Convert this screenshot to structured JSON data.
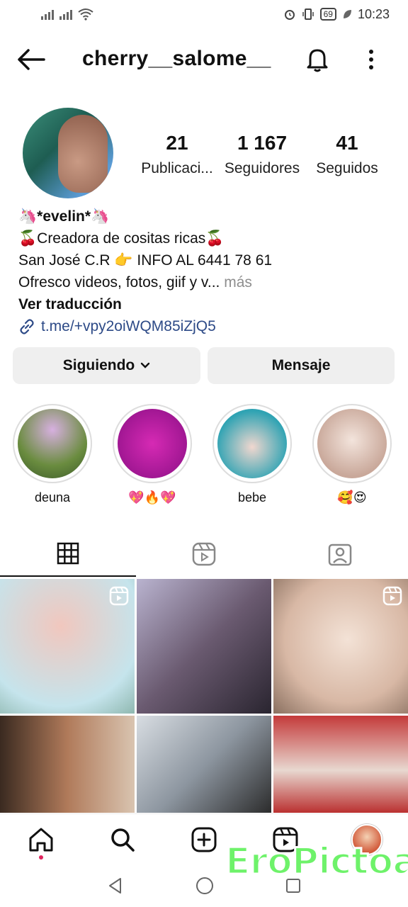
{
  "status_bar": {
    "time": "10:23",
    "battery": "69"
  },
  "header": {
    "username": "cherry__salome__"
  },
  "profile": {
    "stats": [
      {
        "value": "21",
        "label": "Publicaci..."
      },
      {
        "value": "1 167",
        "label": "Seguidores"
      },
      {
        "value": "41",
        "label": "Seguidos"
      }
    ],
    "name": "🦄*evelin*🦄",
    "bio_lines": [
      "🍒Creadora de cositas ricas🍒",
      "San José C.R 👉 INFO AL 6441 78 61",
      "Ofresco videos, fotos, giif y v..."
    ],
    "more": "más",
    "translate": "Ver traducción",
    "link": "t.me/+vpy2oiWQM85iZjQ5"
  },
  "buttons": {
    "following": "Siguiendo",
    "message": "Mensaje"
  },
  "highlights": [
    {
      "label": "deuna"
    },
    {
      "label": "💖🔥💖"
    },
    {
      "label": "bebe"
    },
    {
      "label": "🥰😍"
    }
  ],
  "watermark": "EroPictoa",
  "colors": {
    "link": "#2d4a87",
    "button_bg": "#efefef",
    "muted": "#8e8e8e",
    "watermark": "#6ef26a"
  }
}
